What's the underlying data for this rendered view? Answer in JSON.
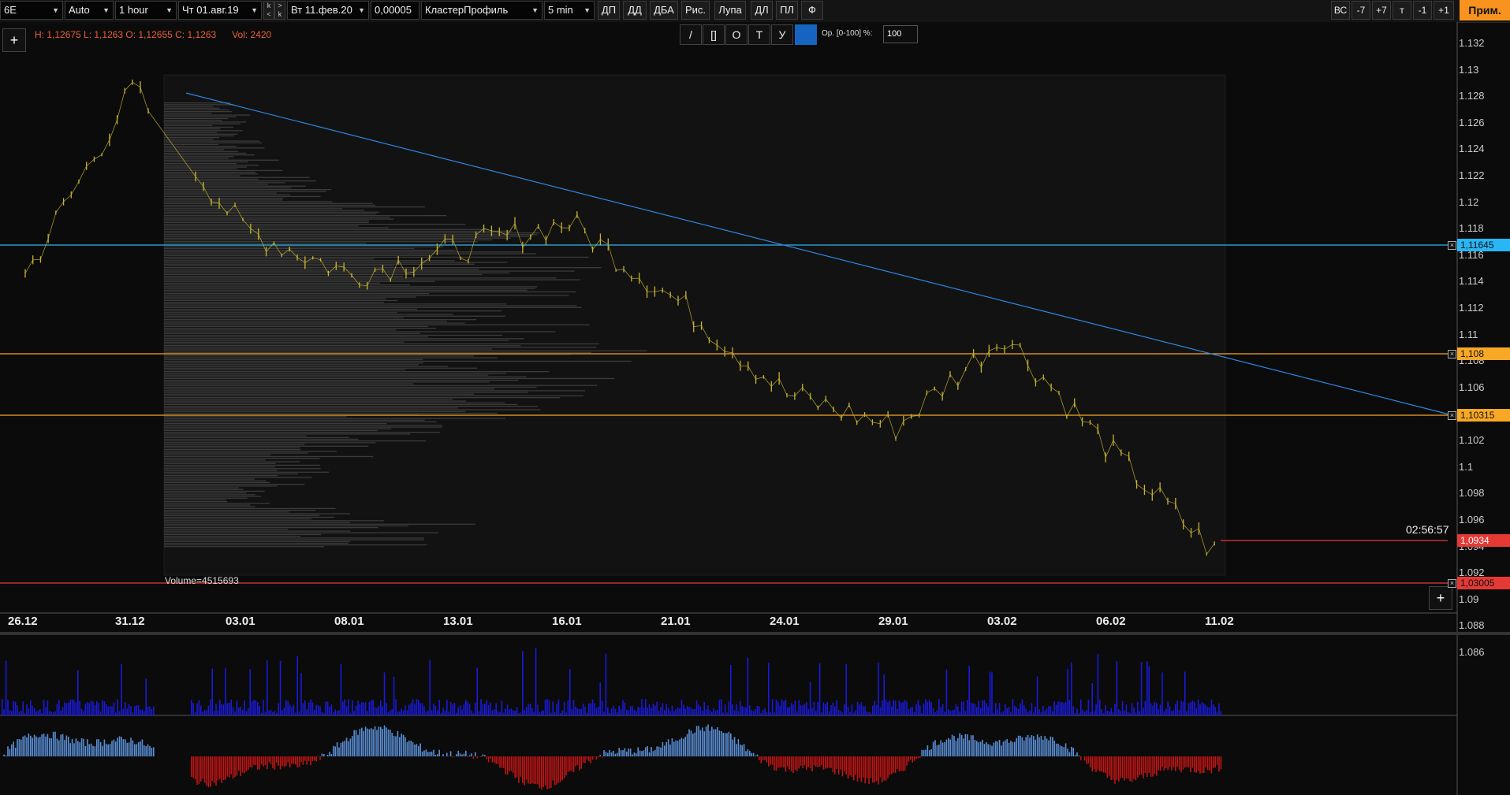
{
  "toolbar": {
    "symbol": "6E",
    "mode": "Auto",
    "timeframe": "1 hour",
    "date_from": "Чт 01.авг.19",
    "date_to": "Вт 11.фев.20",
    "tick_size": "0,00005",
    "chart_type": "КластерПрофиль",
    "cluster_tf": "5 min",
    "buttons": [
      "ДП",
      "ДД",
      "ДБА",
      "Рис.",
      "Лупа",
      "ДЛ",
      "ПЛ",
      "Ф"
    ],
    "right_buttons": [
      "ВС",
      "-7",
      "+7",
      "т",
      "-1",
      "+1"
    ],
    "apply_label": "Прим.",
    "stepper_up": "<",
    "stepper_down": ">",
    "stepper_k": "k"
  },
  "info": {
    "ohlc": "H: 1,12675 L: 1,1263 O: 1,12655 C: 1,1263",
    "volume": "Vol: 2420"
  },
  "drawing_toolbar": {
    "tools": [
      "/",
      "[]",
      "О",
      "Т",
      "У"
    ],
    "opacity_label": "Ор. [0-100] %:",
    "opacity_value": "100"
  },
  "price_axis": {
    "ticks": [
      "1.132",
      "1.13",
      "1.128",
      "1.126",
      "1.124",
      "1.122",
      "1.12",
      "1.118",
      "1.116",
      "1.114",
      "1.112",
      "1.11",
      "1.108",
      "1.106",
      "1.104",
      "1.102",
      "1.1",
      "1.098",
      "1.096",
      "1.094",
      "1.092",
      "1.09",
      "1.088",
      "1.086"
    ],
    "min": 1.086,
    "max": 1.132
  },
  "levels": [
    {
      "label": "1,11645",
      "value": 1.11645,
      "color": "#29b6f6"
    },
    {
      "label": "1,108",
      "value": 1.108,
      "color": "#f9a825"
    },
    {
      "label": "1,10315",
      "value": 1.10315,
      "color": "#f9a825"
    },
    {
      "label": "1,0934",
      "value": 1.0934,
      "color": "#e53935"
    },
    {
      "label": "1,03005",
      "value": 1.03005,
      "color": "#e53935"
    }
  ],
  "dates": [
    "26.12",
    "31.12",
    "03.01",
    "08.01",
    "13.01",
    "16.01",
    "21.01",
    "24.01",
    "29.01",
    "03.02",
    "06.02",
    "11.02"
  ],
  "timer": "02:56:57",
  "profile_volume_label": "Volume=4515693",
  "colors": {
    "price_bars": "#c8b432",
    "volume_bars": "#1a1ad9",
    "delta_pos": "#5a8fd6",
    "delta_neg": "#c01515",
    "trendline": "#2f86e0"
  },
  "chart_data": {
    "type": "line",
    "title": "",
    "series": [
      {
        "x": [
          "26.12",
          "31.12",
          "03.01",
          "08.01",
          "13.01",
          "16.01",
          "21.01",
          "24.01",
          "29.01",
          "03.02",
          "06.02",
          "11.02"
        ],
        "values": [
          1.1145,
          1.1285,
          1.118,
          1.1145,
          1.1165,
          1.1185,
          1.1125,
          1.1055,
          1.103,
          1.11,
          1.101,
          1.093
        ]
      }
    ],
    "ylim": [
      1.086,
      1.132
    ]
  }
}
